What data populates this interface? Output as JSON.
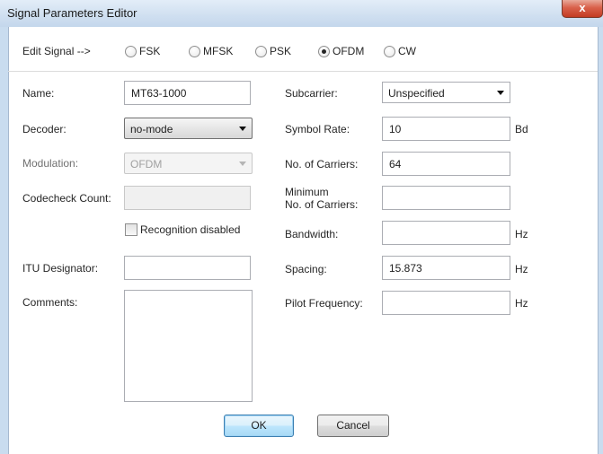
{
  "window": {
    "title": "Signal Parameters Editor",
    "close_glyph": "x"
  },
  "edit_signal": {
    "label": "Edit Signal -->",
    "options": [
      {
        "label": "FSK",
        "selected": false
      },
      {
        "label": "MFSK",
        "selected": false
      },
      {
        "label": "PSK",
        "selected": false
      },
      {
        "label": "OFDM",
        "selected": true
      },
      {
        "label": "CW",
        "selected": false
      }
    ]
  },
  "left": {
    "name_label": "Name:",
    "name_value": "MT63-1000",
    "decoder_label": "Decoder:",
    "decoder_value": "no-mode",
    "modulation_label": "Modulation:",
    "modulation_value": "OFDM",
    "codecheck_label": "Codecheck Count:",
    "codecheck_value": "",
    "recognition_label": "Recognition disabled",
    "recognition_checked": false,
    "itu_label": "ITU Designator:",
    "itu_value": "",
    "comments_label": "Comments:",
    "comments_value": ""
  },
  "right": {
    "subcarrier_label": "Subcarrier:",
    "subcarrier_value": "Unspecified",
    "symbol_rate_label": "Symbol Rate:",
    "symbol_rate_value": "10",
    "symbol_rate_unit": "Bd",
    "carriers_label": "No. of Carriers:",
    "carriers_value": "64",
    "min_carriers_label_line1": "Minimum",
    "min_carriers_label_line2": "No. of Carriers:",
    "min_carriers_value": "",
    "bandwidth_label": "Bandwidth:",
    "bandwidth_value": "",
    "bandwidth_unit": "Hz",
    "spacing_label": "Spacing:",
    "spacing_value": "15.873",
    "spacing_unit": "Hz",
    "pilot_label": "Pilot Frequency:",
    "pilot_value": "",
    "pilot_unit": "Hz"
  },
  "buttons": {
    "ok": "OK",
    "cancel": "Cancel"
  },
  "colors": {
    "titlebar": "#cfdff0",
    "close_button": "#c23b22",
    "default_button_border": "#3c7fb1"
  }
}
